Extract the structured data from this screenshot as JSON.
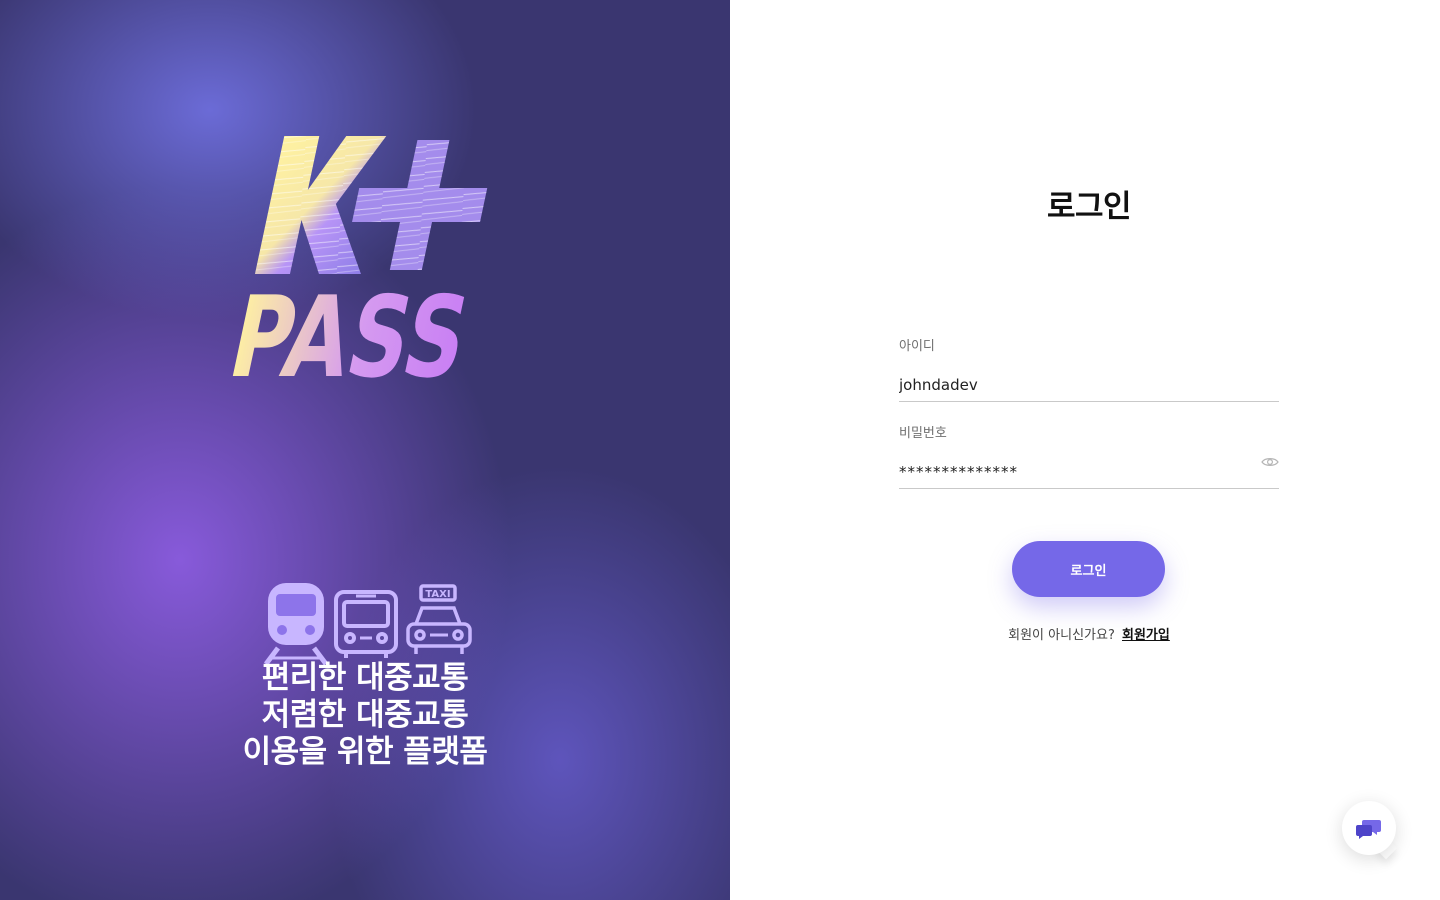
{
  "colors": {
    "brand": "#7568e8",
    "hero_dark": "#3a3670",
    "hero_purple": "#8c5ce0",
    "logo_yellow": "#fff0a0",
    "logo_violet": "#a78bf0"
  },
  "hero": {
    "logo": {
      "line1": "K+",
      "line2": "PASS"
    },
    "icons": [
      "train-icon",
      "bus-icon",
      "taxi-icon"
    ],
    "taxi_label": "TAXI",
    "slogan": [
      "편리한 대중교통",
      "저렴한 대중교통",
      "이용을 위한 플랫폼"
    ]
  },
  "login": {
    "title": "로그인",
    "id_label": "아이디",
    "id_value": "johndadev",
    "password_label": "비밀번호",
    "password_value": "**************",
    "submit_label": "로그인",
    "signup_prompt": "회원이 아니신가요?",
    "signup_link": "회원가입"
  },
  "chat": {
    "icon": "chat-bubbles-icon"
  }
}
